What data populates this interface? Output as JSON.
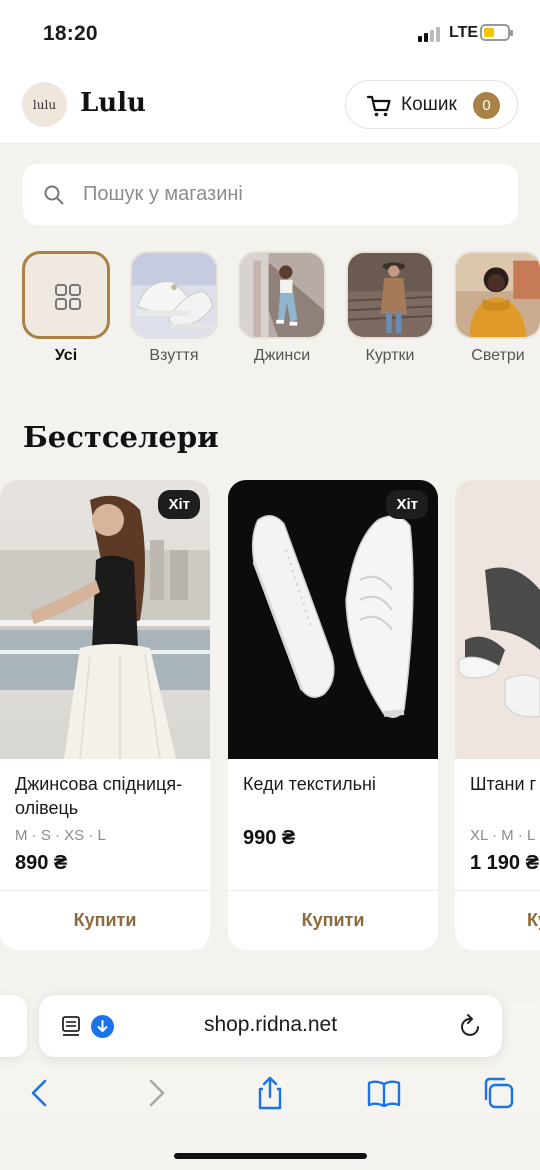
{
  "status": {
    "time": "18:20",
    "network": "LTE"
  },
  "header": {
    "logo_text": "lulu",
    "brand": "Lulu",
    "cart_label": "Кошик",
    "cart_count": "0"
  },
  "search": {
    "placeholder": "Пошук у магазині",
    "value": ""
  },
  "categories": [
    {
      "label": "Усі",
      "active": true
    },
    {
      "label": "Взуття",
      "active": false
    },
    {
      "label": "Джинси",
      "active": false
    },
    {
      "label": "Куртки",
      "active": false
    },
    {
      "label": "Светри",
      "active": false
    }
  ],
  "section_title": "Бестселери",
  "products": [
    {
      "name": "Джинсова спідниця-олівець",
      "sizes": "M · S · XS · L",
      "price": "890 ₴",
      "badge": "Хіт",
      "buy_label": "Купити"
    },
    {
      "name": "Кеди текстильні",
      "sizes": "",
      "price": "990 ₴",
      "badge": "Хіт",
      "buy_label": "Купити"
    },
    {
      "name": "Штани г",
      "sizes": "XL · M · L",
      "price": "1 190 ₴",
      "badge": "",
      "buy_label": "Ку"
    }
  ],
  "browser": {
    "url": "shop.ridna.net"
  },
  "colors": {
    "accent": "#a98146",
    "background": "#f3f2ee",
    "link_blue": "#1a73e8"
  }
}
